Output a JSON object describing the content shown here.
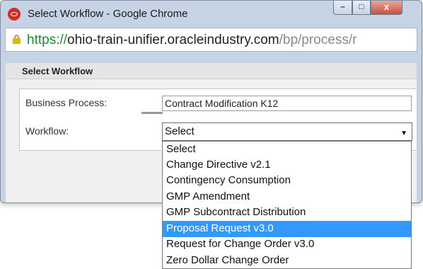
{
  "window": {
    "title": "Select Workflow - Google Chrome",
    "minimize_glyph": "–",
    "maximize_glyph": "□",
    "close_glyph": "x"
  },
  "address_bar": {
    "scheme": "https://",
    "domain": "ohio-train-unifier.oracleindustry.com",
    "path": "/bp/process/r"
  },
  "dialog": {
    "section_title": "Select Workflow",
    "business_process_label": "Business Process:",
    "business_process_value": "Contract Modification K12",
    "workflow_label": "Workflow:",
    "workflow_selected": "Select",
    "workflow_arrow": "▼"
  },
  "dropdown": {
    "options": [
      "Select",
      "Change Directive v2.1",
      "Contingency Consumption",
      "GMP Amendment",
      "GMP Subcontract Distribution",
      "Proposal Request v3.0",
      "Request for Change Order v3.0",
      "Zero Dollar Change Order"
    ],
    "highlighted": "Proposal Request v3.0"
  },
  "colors": {
    "window_frame": "#c5d3e4",
    "highlight": "#3399ff",
    "secure_scheme": "#1e8a2e"
  }
}
